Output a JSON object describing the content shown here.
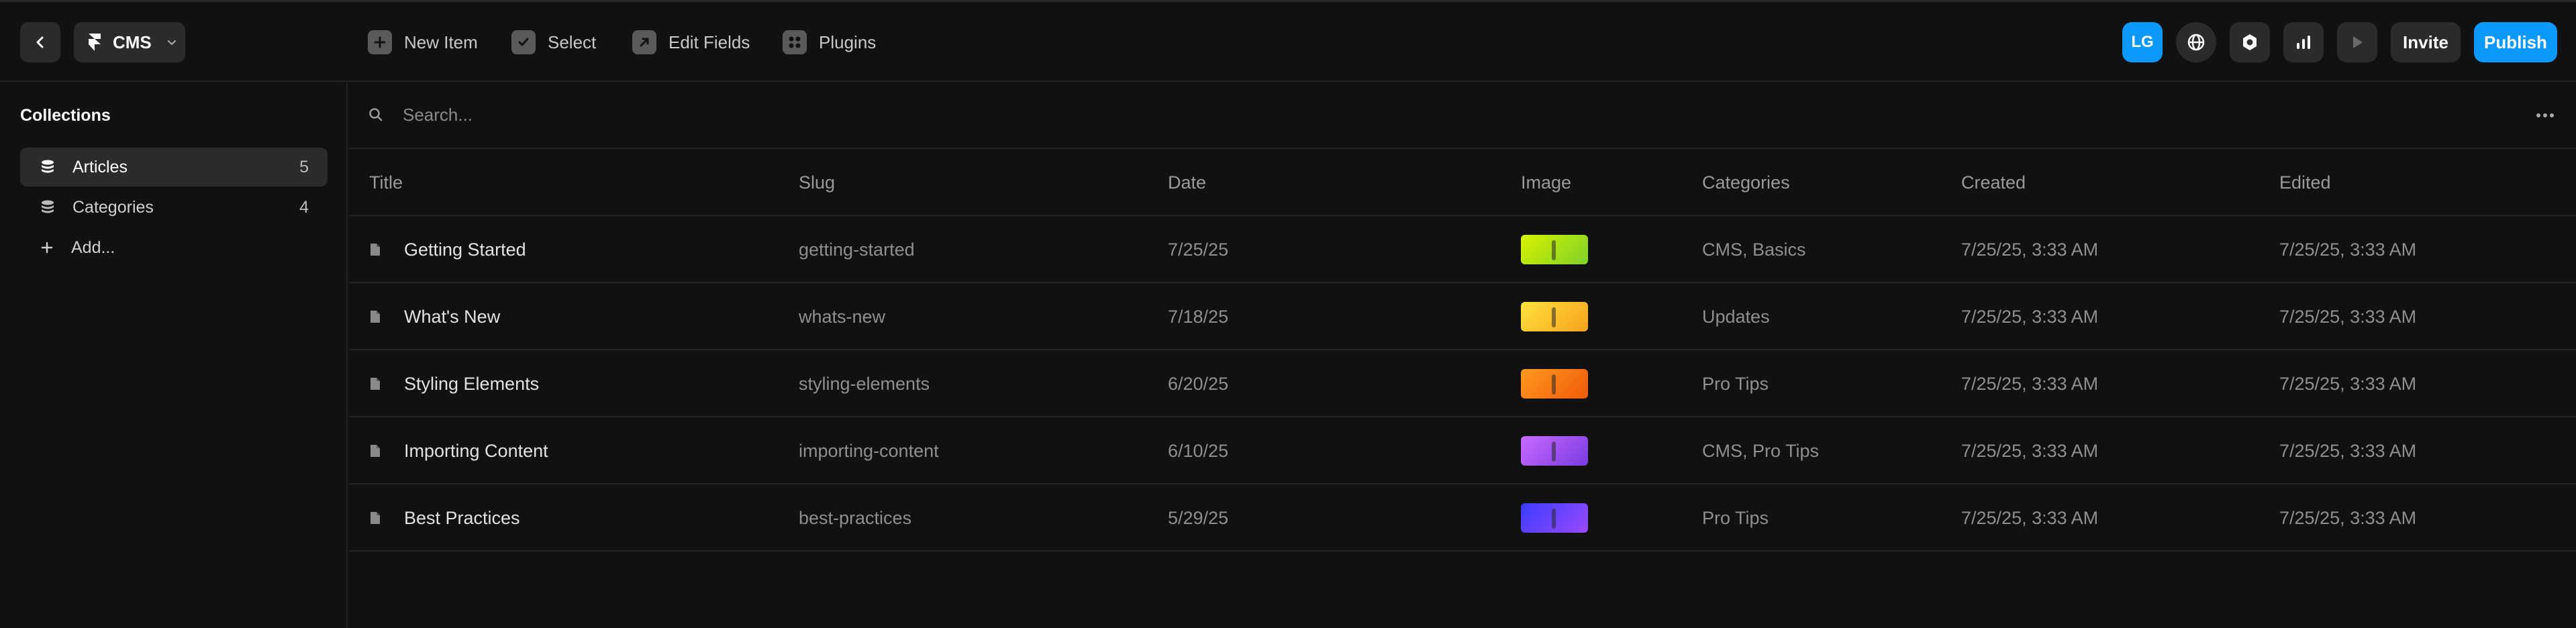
{
  "topbar": {
    "back_icon": "chevron-left-icon",
    "project": {
      "icon": "framer-logo-icon",
      "label": "CMS",
      "chevron": "chevron-down-icon"
    },
    "tools": [
      {
        "icon": "plus-square-icon",
        "label": "New Item"
      },
      {
        "icon": "check-square-icon",
        "label": "Select"
      },
      {
        "icon": "edit-arrow-icon",
        "label": "Edit Fields"
      },
      {
        "icon": "plugins-grid-icon",
        "label": "Plugins"
      }
    ],
    "avatar_initials": "LG",
    "right_icons": [
      "globe-icon",
      "settings-hex-icon",
      "analytics-icon",
      "play-icon"
    ],
    "invite_label": "Invite",
    "publish_label": "Publish",
    "accent": "#0b99ff"
  },
  "sidebar": {
    "title": "Collections",
    "items": [
      {
        "icon": "database-icon",
        "label": "Articles",
        "count": "5",
        "active": true
      },
      {
        "icon": "database-icon",
        "label": "Categories",
        "count": "4",
        "active": false
      }
    ],
    "add_label": "Add..."
  },
  "search": {
    "placeholder": "Search..."
  },
  "table": {
    "columns": [
      "Title",
      "Slug",
      "Date",
      "Image",
      "Categories",
      "Created",
      "Edited"
    ],
    "rows": [
      {
        "title": "Getting Started",
        "slug": "getting-started",
        "date": "7/25/25",
        "image": "green-yellow",
        "categories": "CMS, Basics",
        "created": "7/25/25, 3:33 AM",
        "edited": "7/25/25, 3:33 AM"
      },
      {
        "title": "What's New",
        "slug": "whats-new",
        "date": "7/18/25",
        "image": "yellow-orange",
        "categories": "Updates",
        "created": "7/25/25, 3:33 AM",
        "edited": "7/25/25, 3:33 AM"
      },
      {
        "title": "Styling Elements",
        "slug": "styling-elements",
        "date": "6/20/25",
        "image": "orange",
        "categories": "Pro Tips",
        "created": "7/25/25, 3:33 AM",
        "edited": "7/25/25, 3:33 AM"
      },
      {
        "title": "Importing Content",
        "slug": "importing-content",
        "date": "6/10/25",
        "image": "purple",
        "categories": "CMS, Pro Tips",
        "created": "7/25/25, 3:33 AM",
        "edited": "7/25/25, 3:33 AM"
      },
      {
        "title": "Best Practices",
        "slug": "best-practices",
        "date": "5/29/25",
        "image": "blue-violet",
        "categories": "Pro Tips",
        "created": "7/25/25, 3:33 AM",
        "edited": "7/25/25, 3:33 AM"
      }
    ],
    "thumb_colors": {
      "green-yellow": [
        "#d8f200",
        "#7fd12a"
      ],
      "yellow-orange": [
        "#ffe23d",
        "#f6a21c"
      ],
      "orange": [
        "#ff9a1f",
        "#f05a0a"
      ],
      "purple": [
        "#c86bff",
        "#7a3be0"
      ],
      "blue-violet": [
        "#3a3bff",
        "#9a4bff"
      ]
    }
  }
}
